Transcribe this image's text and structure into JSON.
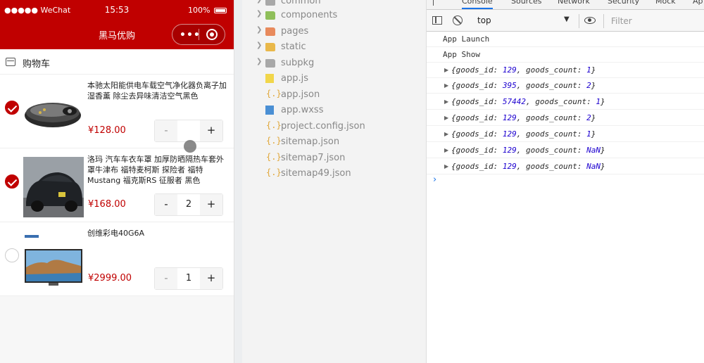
{
  "phone": {
    "status": {
      "carrier": "●●●●● WeChat",
      "time": "15:53",
      "battery": "100%"
    },
    "nav": {
      "title": "黑马优购",
      "menu_icon": "more-dots-icon",
      "close_icon": "target-icon"
    },
    "cart_header": {
      "icon": "shop-icon",
      "label": "购物车"
    },
    "items": [
      {
        "checked": true,
        "title": "本驰太阳能供电车载空气净化器负离子加湿香薰 除尘去异味清洁空气黑色",
        "price": "¥128.00",
        "qty": "",
        "minus": "-",
        "plus": "+"
      },
      {
        "checked": true,
        "title": "洛玛 汽车车衣车罩 加厚防晒隔热车套外罩牛津布 福特麦柯斯 探险者 福特Mustang 福克斯RS 征服者 黑色",
        "price": "¥168.00",
        "qty": "2",
        "minus": "-",
        "plus": "+"
      },
      {
        "checked": false,
        "title": "创维彩电40G6A",
        "price": "¥2999.00",
        "qty": "1",
        "minus": "-",
        "plus": "+"
      }
    ]
  },
  "explorer": {
    "items": [
      {
        "name": "common",
        "type": "folder",
        "color": "#a8a8a8",
        "expandable": true
      },
      {
        "name": "components",
        "type": "folder",
        "color": "#8fbf5a",
        "expandable": true
      },
      {
        "name": "pages",
        "type": "folder",
        "color": "#e88a5c",
        "expandable": true
      },
      {
        "name": "static",
        "type": "folder",
        "color": "#e9b84a",
        "expandable": true
      },
      {
        "name": "subpkg",
        "type": "folder",
        "color": "#a8a8a8",
        "expandable": true
      },
      {
        "name": "app.js",
        "type": "js",
        "expandable": false
      },
      {
        "name": "app.json",
        "type": "json",
        "expandable": false
      },
      {
        "name": "app.wxss",
        "type": "css",
        "expandable": false
      },
      {
        "name": "project.config.json",
        "type": "json",
        "expandable": false
      },
      {
        "name": "sitemap.json",
        "type": "json",
        "expandable": false
      },
      {
        "name": "sitemap7.json",
        "type": "json",
        "expandable": false
      },
      {
        "name": "sitemap49.json",
        "type": "json",
        "expandable": false
      }
    ]
  },
  "devtools": {
    "tabs": [
      "Console",
      "Sources",
      "Network",
      "Security",
      "Mock",
      "Ap"
    ],
    "active_tab": "Console",
    "toolbar": {
      "context": "top",
      "filter_placeholder": "Filter"
    },
    "logs": [
      {
        "kind": "text",
        "text": "App Launch"
      },
      {
        "kind": "text",
        "text": "App Show"
      },
      {
        "kind": "object",
        "goods_id": "129",
        "goods_count": "1"
      },
      {
        "kind": "object",
        "goods_id": "395",
        "goods_count": "2"
      },
      {
        "kind": "object",
        "goods_id": "57442",
        "goods_count": "1"
      },
      {
        "kind": "object",
        "goods_id": "129",
        "goods_count": "2"
      },
      {
        "kind": "object",
        "goods_id": "129",
        "goods_count": "1"
      },
      {
        "kind": "object",
        "goods_id": "129",
        "goods_count": "NaN"
      },
      {
        "kind": "object",
        "goods_id": "129",
        "goods_count": "NaN"
      }
    ],
    "prompt": "›",
    "accent": "#1a73e8"
  }
}
